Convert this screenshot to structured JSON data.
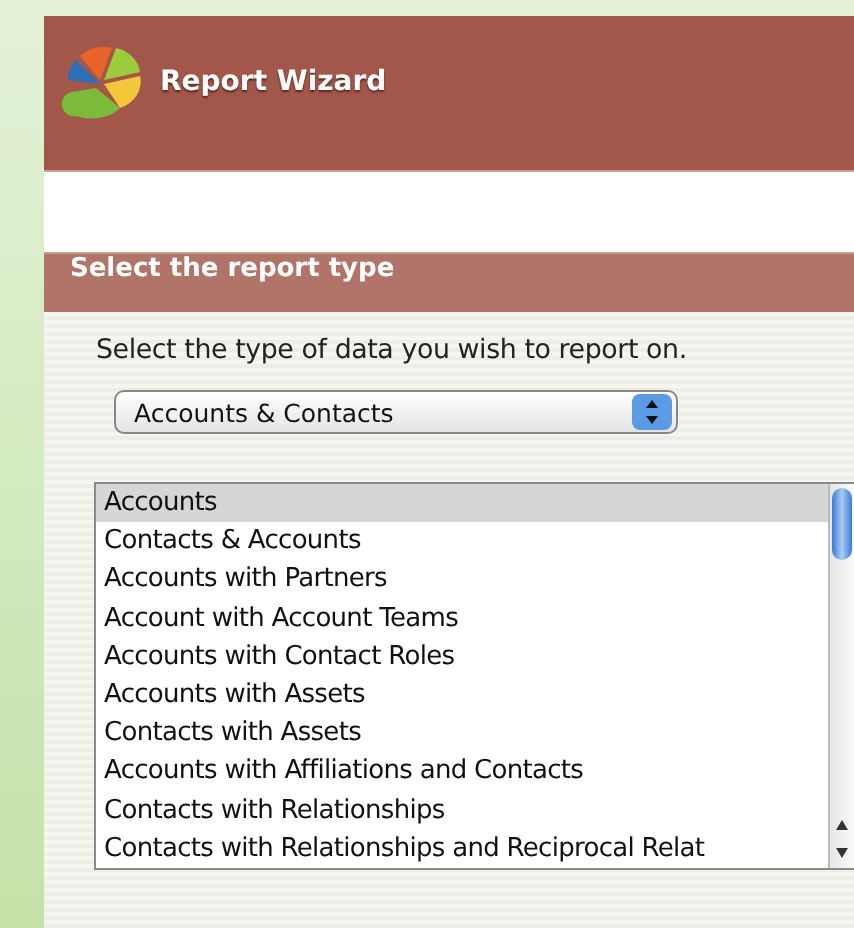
{
  "window": {
    "title": "Report Wizard"
  },
  "section": {
    "title": "Select the report type",
    "prompt": "Select the type of data you wish to report on.",
    "category": {
      "value": "Accounts & Contacts"
    },
    "report_types": [
      {
        "label": "Accounts",
        "selected": true
      },
      {
        "label": "Contacts & Accounts",
        "selected": false
      },
      {
        "label": "Accounts with Partners",
        "selected": false
      },
      {
        "label": "Account with Account Teams",
        "selected": false
      },
      {
        "label": "Accounts with Contact Roles",
        "selected": false
      },
      {
        "label": "Accounts with Assets",
        "selected": false
      },
      {
        "label": "Contacts with Assets",
        "selected": false
      },
      {
        "label": "Accounts with Affiliations and Contacts",
        "selected": false
      },
      {
        "label": "Contacts with Relationships",
        "selected": false
      },
      {
        "label": "Contacts with Relationships and Reciprocal Relat",
        "selected": false
      }
    ]
  }
}
